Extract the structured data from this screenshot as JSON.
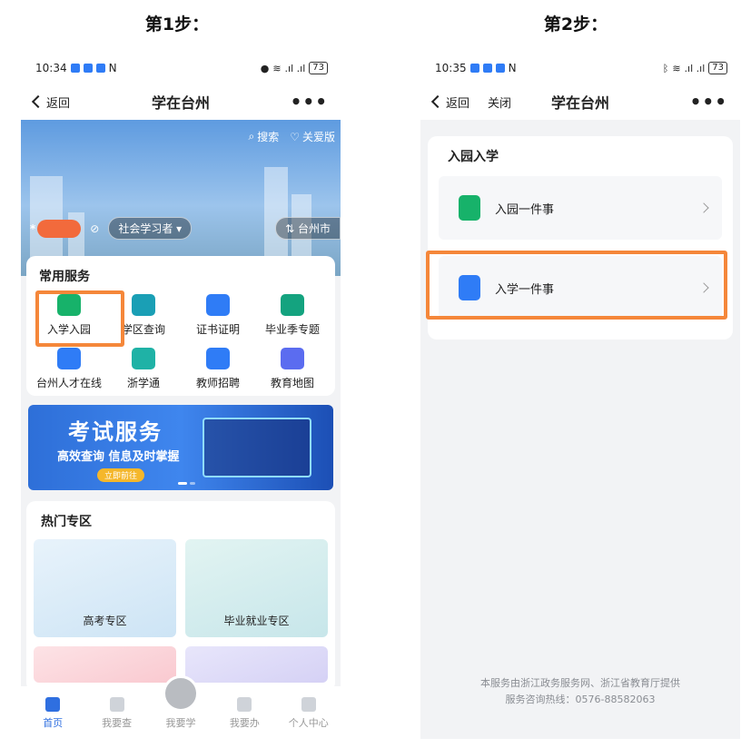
{
  "step1": {
    "label": "第1步：",
    "status": {
      "time": "10:34",
      "battery": "73"
    },
    "nav": {
      "back": "返回",
      "title": "学在台州",
      "more": "•••"
    },
    "hero": {
      "search": "搜索",
      "care": "关爱版",
      "role": "社会学习者",
      "city": "台州市",
      "name_initial": "*"
    },
    "services": {
      "title": "常用服务",
      "items": [
        {
          "label": "入学入园",
          "color": "#17b26a"
        },
        {
          "label": "学区查询",
          "color": "#1a9fb5"
        },
        {
          "label": "证书证明",
          "color": "#2f7cf6"
        },
        {
          "label": "毕业季专题",
          "color": "#14a37f"
        },
        {
          "label": "台州人才在线",
          "color": "#2f7cf6"
        },
        {
          "label": "浙学通",
          "color": "#1fb2a6"
        },
        {
          "label": "教师招聘",
          "color": "#2f7cf6"
        },
        {
          "label": "教育地图",
          "color": "#5b6cf0"
        }
      ]
    },
    "banner": {
      "title": "考试服务",
      "subtitle": "高效查询 信息及时掌握",
      "button": "立即前往"
    },
    "hot": {
      "title": "热门专区",
      "cards": [
        "高考专区",
        "毕业就业专区"
      ]
    },
    "tabs": [
      {
        "label": "首页",
        "active": true
      },
      {
        "label": "我要查",
        "active": false
      },
      {
        "label": "我要学",
        "active": false
      },
      {
        "label": "我要办",
        "active": false
      },
      {
        "label": "个人中心",
        "active": false
      }
    ]
  },
  "step2": {
    "label": "第2步：",
    "status": {
      "time": "10:35",
      "battery": "73"
    },
    "nav": {
      "back": "返回",
      "close": "关闭",
      "title": "学在台州",
      "more": "•••"
    },
    "section": {
      "title": "入园入学",
      "items": [
        {
          "label": "入园一件事",
          "color": "#17b26a"
        },
        {
          "label": "入学一件事",
          "color": "#2f7cf6"
        }
      ]
    },
    "footer": {
      "line1": "本服务由浙江政务服务网、浙江省教育厅提供",
      "line2": "服务咨询热线：0576-88582063"
    }
  },
  "colors": {
    "highlight": "#f5873a",
    "accent": "#2f6fe0"
  }
}
